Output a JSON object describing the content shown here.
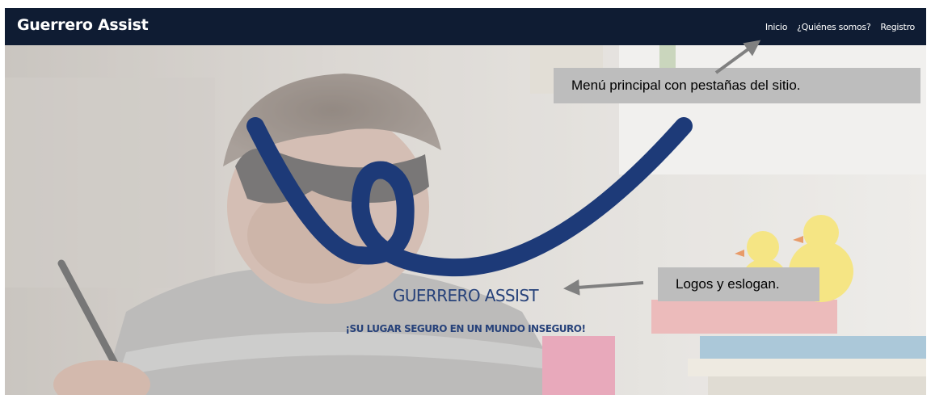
{
  "navbar": {
    "brand": "Guerrero Assist",
    "links": [
      "Inicio",
      "¿Quiénes somos?",
      "Registro"
    ],
    "background_color": "#0f1c33"
  },
  "hero": {
    "title": "GUERRERO ASSIST",
    "slogan": "¡SU LUGAR SEGURO EN UN MUNDO INSEGURO!",
    "logo_color": "#1d3a78",
    "text_color": "#27427a"
  },
  "annotations": {
    "menu_note": "Menú principal con pestañas del sitio.",
    "logo_note": "Logos y eslogan."
  }
}
